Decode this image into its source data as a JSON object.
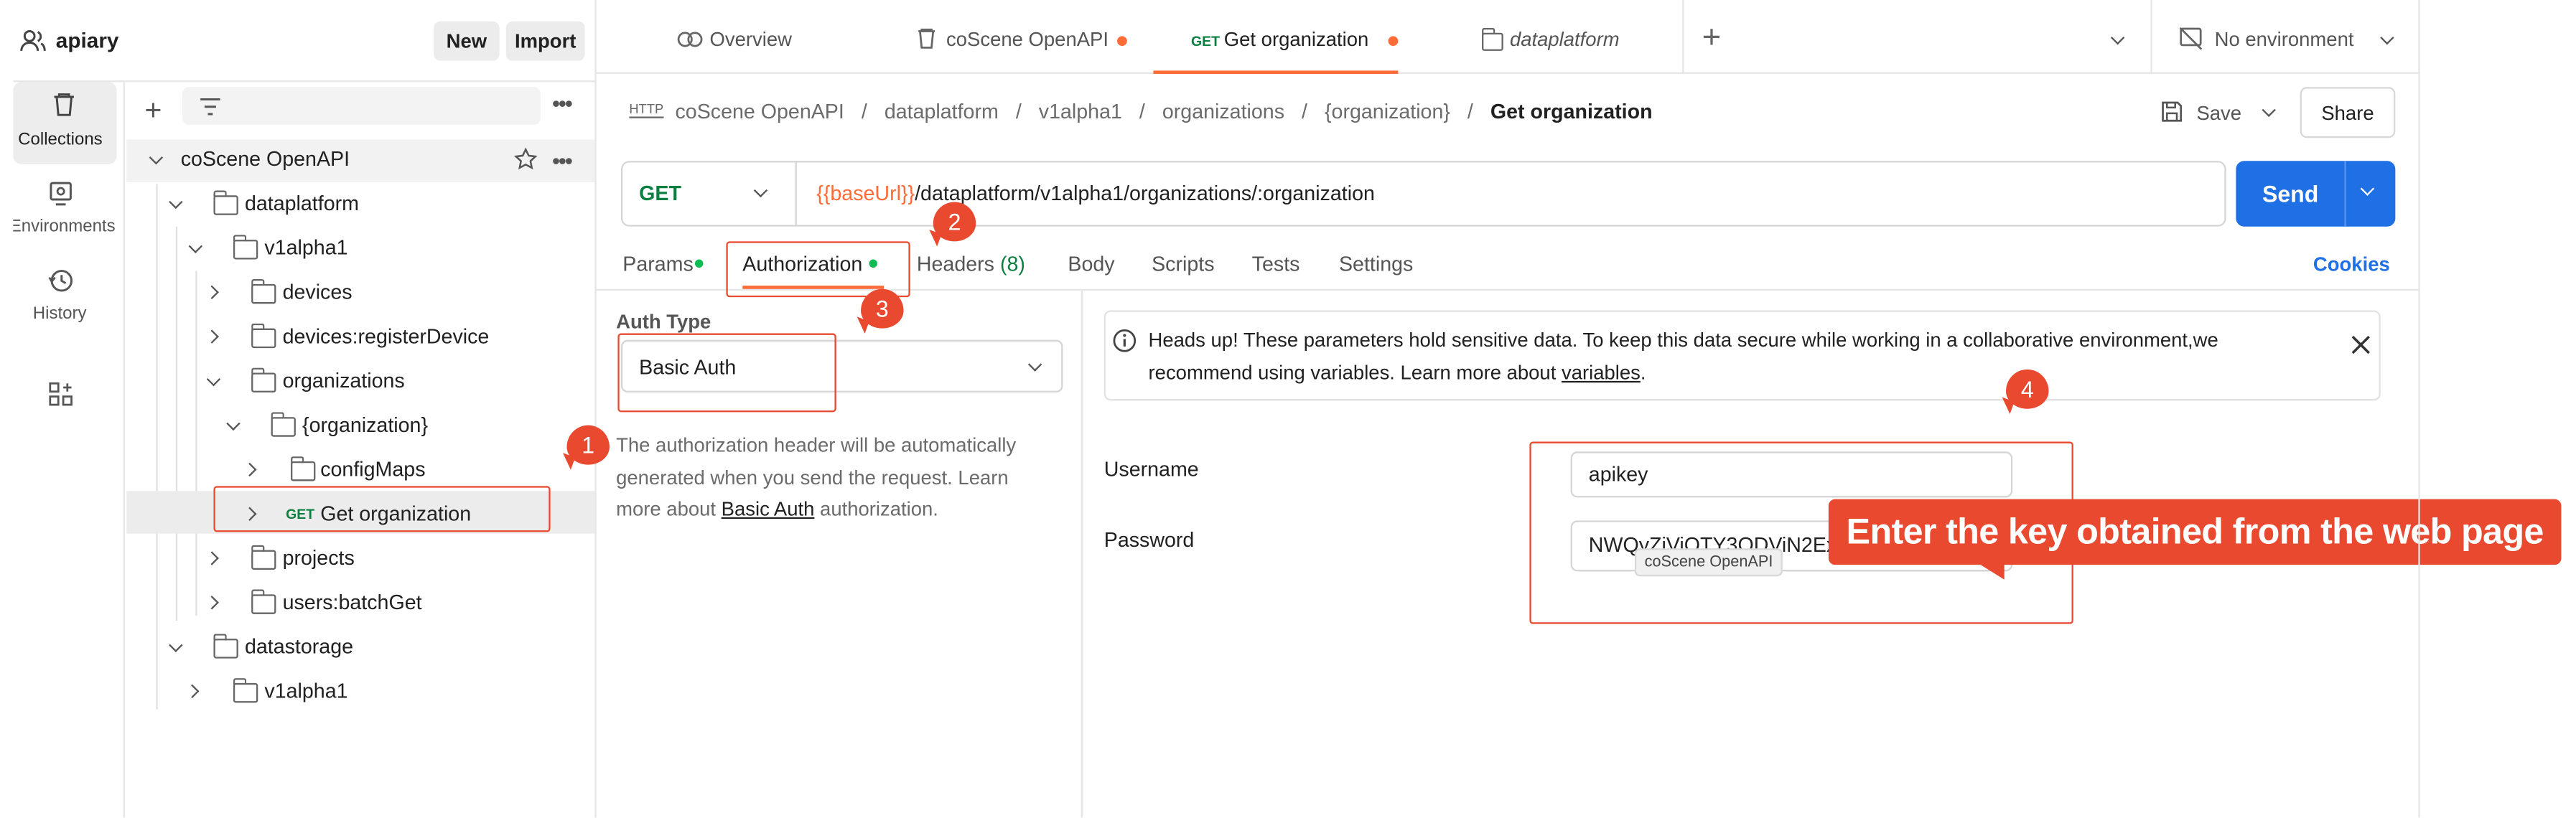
{
  "sidebar": {
    "workspace": "apiary",
    "new_label": "New",
    "import_label": "Import",
    "nav": [
      {
        "label": "Collections"
      },
      {
        "label": "Environments"
      },
      {
        "label": "History"
      }
    ],
    "tree": {
      "root": "coScene OpenAPI",
      "dataplatform": "dataplatform",
      "v1alpha1": "v1alpha1",
      "devices": "devices",
      "devices_register": "devices:registerDevice",
      "organizations": "organizations",
      "organization": "{organization}",
      "configMaps": "configMaps",
      "get_method": "GET",
      "get_org": "Get organization",
      "projects": "projects",
      "users_batch": "users:batchGet",
      "datastorage": "datastorage",
      "v1alpha1_2": "v1alpha1"
    }
  },
  "tabs": [
    {
      "label": "Overview"
    },
    {
      "label": "coScene OpenAPI"
    },
    {
      "method": "GET",
      "label": "Get organization"
    },
    {
      "label": "dataplatform"
    }
  ],
  "environment": "No environment",
  "breadcrumb": {
    "protocol": "HTTP",
    "items": [
      "coScene OpenAPI",
      "dataplatform",
      "v1alpha1",
      "organizations",
      "{organization}"
    ],
    "current": "Get organization"
  },
  "actions": {
    "save": "Save",
    "share": "Share"
  },
  "request": {
    "method": "GET",
    "url_var": "{{baseUrl}}",
    "url_path": "/dataplatform/v1alpha1/organizations/:organization",
    "send": "Send"
  },
  "req_tabs": {
    "params": "Params",
    "authorization": "Authorization",
    "headers": "Headers",
    "headers_count": "(8)",
    "body": "Body",
    "scripts": "Scripts",
    "tests": "Tests",
    "settings": "Settings",
    "cookies": "Cookies"
  },
  "auth": {
    "type_label": "Auth Type",
    "type_value": "Basic Auth",
    "desc_before": "The authorization header will be automatically generated when you send the request. Learn more about ",
    "desc_link": "Basic Auth",
    "desc_after": " authorization.",
    "notice_before": "Heads up! These parameters hold sensitive data. To keep this data secure while working in a collaborative environment,we recommend using variables. Learn more about ",
    "notice_link": "variables",
    "notice_after": ".",
    "username_label": "Username",
    "username_value": "apikey",
    "password_label": "Password",
    "password_value": "NWQyZjViOTY3ODViN2ExO"
  },
  "tooltip": "coScene OpenAPI",
  "annotations": {
    "b1": "1",
    "b2": "2",
    "b3": "3",
    "b4": "4",
    "callout": "Enter the key obtained from the web page"
  },
  "colors": {
    "accent": "#1f6fe5",
    "brand_orange": "#ff6c37",
    "annotation_red": "#e8492f",
    "get_green": "#0a7f3f"
  }
}
